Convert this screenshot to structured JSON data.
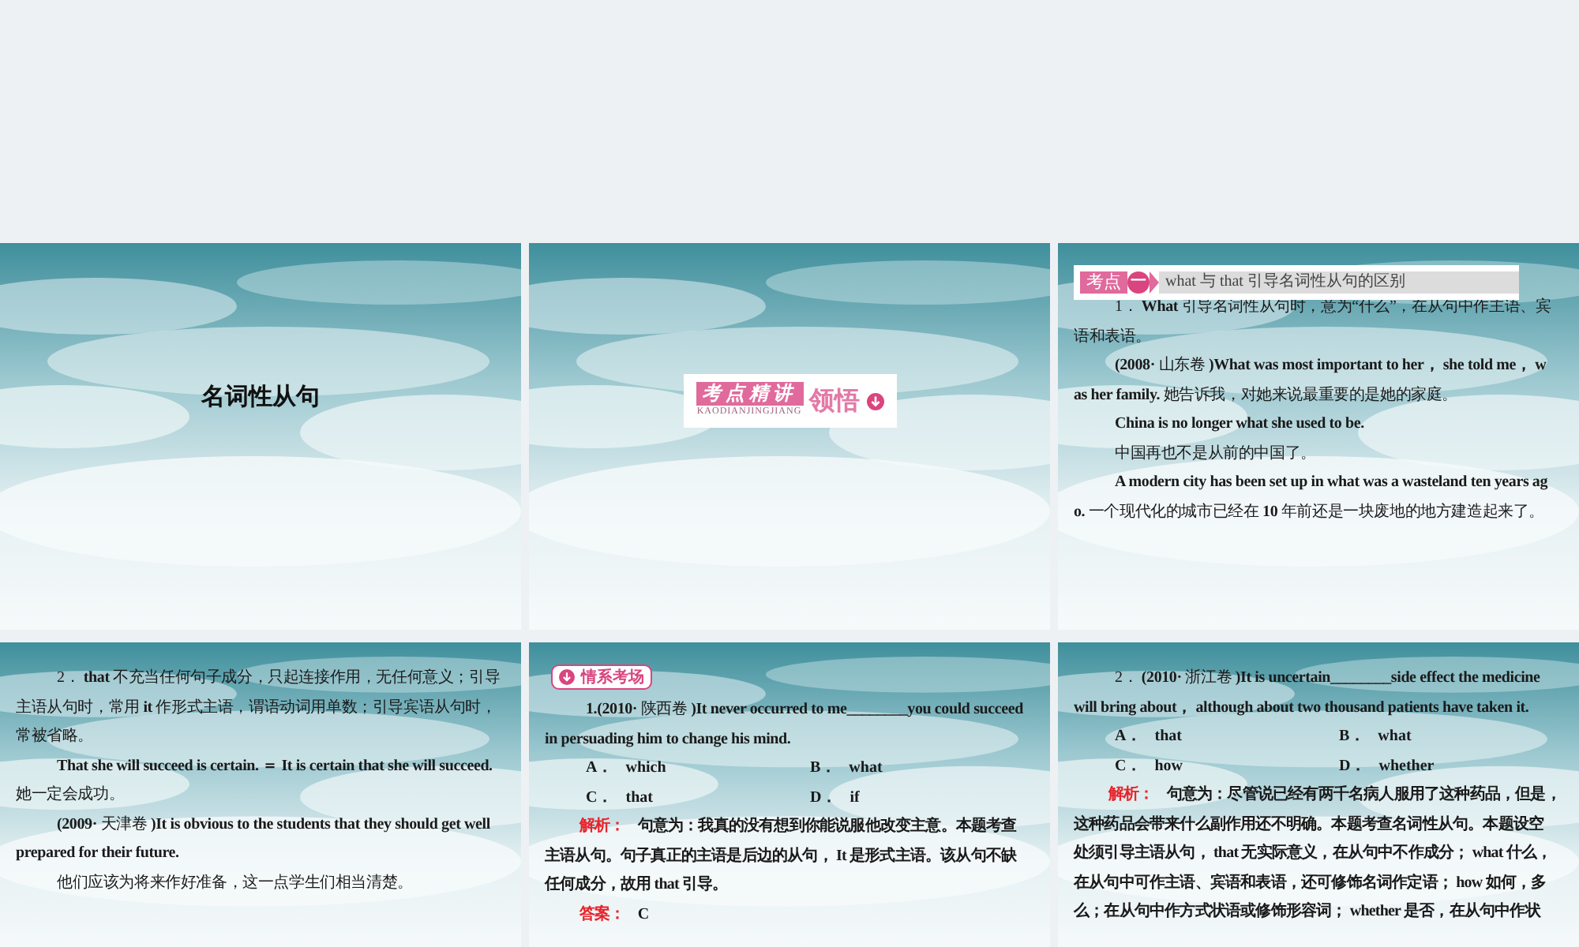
{
  "slides": [
    {
      "kind": "title",
      "title": "名词性从句"
    },
    {
      "kind": "banner",
      "tag": "考点精讲",
      "pinyin": "KAODIANJINGJIANG",
      "word": "领悟"
    },
    {
      "kind": "content",
      "header": {
        "kind": "section",
        "tag": "考点",
        "number": "一",
        "title": "what 与 that 引导名词性从句的区别"
      },
      "paragraphs": [
        {
          "kind": "text",
          "lines": [
            "1． **What** 引导名词性从句时，意为“什么”，在从句中作主语、宾",
            "语和表语。"
          ]
        },
        {
          "kind": "text",
          "lines": [
            "**(2008·** 山东卷 **)What was most important to her， she told me， w**",
            "**as her family.** 她告诉我，对她来说最重要的是她的家庭。"
          ]
        },
        {
          "kind": "text",
          "lines": [
            "**China is no longer what she used to be.**"
          ]
        },
        {
          "kind": "text",
          "lines": [
            "中国再也不是从前的中国了。"
          ]
        },
        {
          "kind": "text",
          "lines": [
            "**A modern city has been set up in what was a wasteland ten years ag**",
            "**o.** 一个现代化的城市已经在 **10** 年前还是一块废地的地方建造起来了。"
          ]
        }
      ]
    },
    {
      "kind": "content",
      "paragraphs": [
        {
          "kind": "text",
          "lines": [
            "2． **that** 不充当任何句子成分，只起连接作用，无任何意义；引导",
            "主语从句时，常用 **it** 作形式主语，谓语动词用单数；引导宾语从句时，",
            "常被省略。"
          ]
        },
        {
          "kind": "text",
          "lines": [
            "**That she will succeed is certain. ＝ It is certain that she will succeed.**",
            "她一定会成功。"
          ]
        },
        {
          "kind": "text",
          "lines": [
            "**(2009·** 天津卷 **)It is obvious to the students that they should get well**",
            "**prepared for their future.**"
          ]
        },
        {
          "kind": "text",
          "lines": [
            "他们应该为将来作好准备，这一点学生们相当清楚。"
          ]
        }
      ]
    },
    {
      "kind": "content",
      "header": {
        "kind": "pill",
        "title": "情系考场"
      },
      "paragraphs": [
        {
          "kind": "text",
          "lines": [
            "**1.(2010·** 陕西卷 **)It never occurred to me________you could succeed**",
            "**in persuading him to change his mind.**"
          ]
        },
        {
          "kind": "options",
          "options": [
            [
              "A．",
              "which"
            ],
            [
              "B．",
              "what"
            ],
            [
              "C．",
              "that"
            ],
            [
              "D．",
              "if"
            ]
          ]
        },
        {
          "kind": "labeled",
          "label": "解析：",
          "lines": [
            "句意为：我真的没有想到你能说服他改变主意。本题考查",
            "主语从句。句子真正的主语是后边的从句， It 是形式主语。该从句不缺",
            "任何成分，故用 that 引导。"
          ]
        },
        {
          "kind": "labeled",
          "label": "答案：",
          "lines": [
            "C"
          ]
        }
      ]
    },
    {
      "kind": "content",
      "paragraphs": [
        {
          "kind": "text",
          "lines": [
            "2． **(2010·** 浙江卷 **)It is uncertain________side effect the medicine**",
            "**will bring about， although about two thousand patients have taken it.**"
          ]
        },
        {
          "kind": "options",
          "options": [
            [
              "A．",
              "that"
            ],
            [
              "B．",
              "what"
            ],
            [
              "C．",
              "how"
            ],
            [
              "D．",
              "whether"
            ]
          ]
        },
        {
          "kind": "labeled",
          "label": "解析：",
          "lines": [
            "句意为：尽管说已经有两千名病人服用了这种药品，但是，",
            "这种药品会带来什么副作用还不明确。本题考查名词性从句。本题设空",
            "处须引导主语从句， that 无实际意义，在从句中不作成分； what 什么，",
            "在从句中可作主语、宾语和表语，还可修饰名词作定语； how 如何，多",
            "么；在从句中作方式状语或修饰形容词； whether 是否，在从句中作状"
          ]
        }
      ]
    }
  ]
}
